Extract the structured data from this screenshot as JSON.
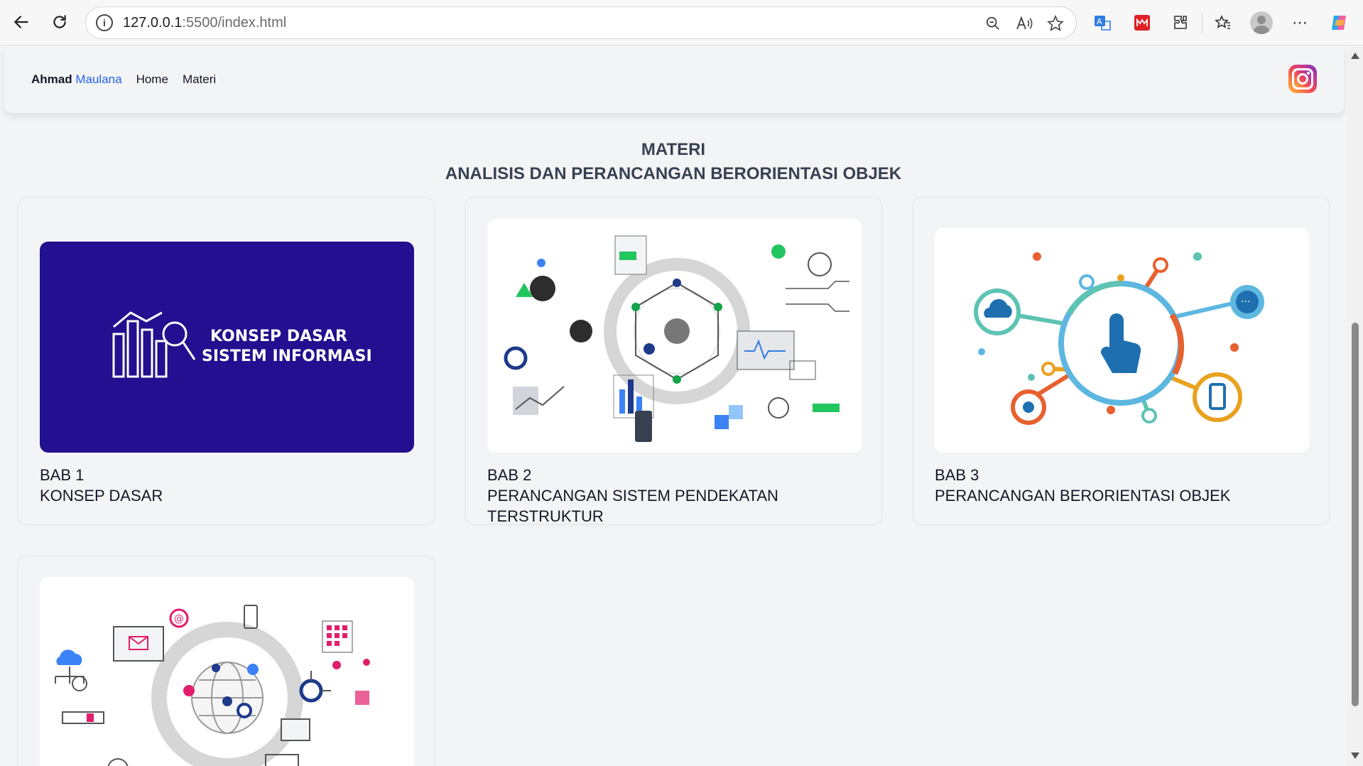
{
  "browser": {
    "url_host": "127.0.0.1",
    "url_rest": ":5500/index.html"
  },
  "navbar": {
    "brand_first": "Ahmad",
    "brand_second": "Maulana",
    "links": [
      "Home",
      "Materi"
    ]
  },
  "page": {
    "title": "MATERI",
    "subtitle": "ANALISIS DAN PERANCANGAN BERORIENTASI OBJEK"
  },
  "cards": [
    {
      "chapter": "BAB 1",
      "name": "KONSEP DASAR",
      "banner_line1": "KONSEP DASAR",
      "banner_line2": "SISTEM INFORMASI"
    },
    {
      "chapter": "BAB 2",
      "name": "PERANCANGAN SISTEM PENDEKATAN TERSTRUKTUR"
    },
    {
      "chapter": "BAB 3",
      "name": "PERANCANGAN BERORIENTASI OBJEK"
    },
    {
      "chapter": "",
      "name": ""
    }
  ],
  "colors": {
    "accent": "#2563eb",
    "banner_bg": "#230f8f"
  }
}
